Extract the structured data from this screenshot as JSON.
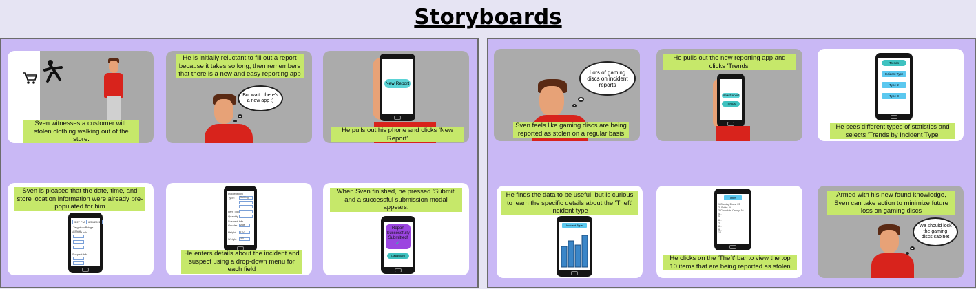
{
  "page": {
    "title": "Storyboards"
  },
  "colors": {
    "caption_bg": "#c6e86a",
    "board_bg": "#c9b8f5",
    "panel_gray": "#ababab",
    "shirt": "#d8231c",
    "teal": "#3fc2c0",
    "sky": "#5bc8ef",
    "purple": "#9b45e0"
  },
  "board1": {
    "p1": {
      "caption": "Sven witnesses a customer with stolen clothing walking out of the store."
    },
    "p2": {
      "caption": "He is initially reluctant to fill out a report because it takes so long, then remembers that there is a new and easy reporting app",
      "thought": "But wait...there's a new app :)"
    },
    "p3": {
      "caption": "He pulls out his phone and clicks 'New Report'",
      "button": "New Report"
    },
    "p4": {
      "caption": "Sven is pleased that the date, time, and store location information were already pre-populated for him",
      "time": "3:27 PM",
      "date": "6/24/2022",
      "target": "Target on Bridge - 03048",
      "incident_info": "Incident Info",
      "suspect_info": "Suspect Info"
    },
    "p5": {
      "caption": "He enters details about the incident and suspect using a drop-down menu for each field",
      "incident_info": "Incident Info",
      "type_label": "Type:",
      "type_value": "Clothing",
      "item_type_label": "Item Type",
      "quantity_label": "Quantity",
      "suspect_info": "Suspect Info",
      "gender_label": "Gender",
      "gender_value": "Male",
      "height_label": "Height",
      "height_value": "5'10",
      "weight_label": "Weight",
      "weight_value": "160"
    },
    "p6": {
      "caption": "When Sven finished, he pressed 'Submit' and a successful submission modal appears.",
      "modal": "Report Successfully Submitted!",
      "button": "Dashboard"
    }
  },
  "board2": {
    "p1": {
      "caption": "Sven feels like gaming discs are being reported as stolen on a regular basis",
      "thought": "Lots of gaming discs on incident reports"
    },
    "p2": {
      "caption": "He pulls out the new reporting app and clicks 'Trends'",
      "btn1": "New Report",
      "btn2": "Trends"
    },
    "p3": {
      "caption": "He sees different types of statistics and selects 'Trends by Incident Type'",
      "btn1": "Trends",
      "btn2": "Incident Type",
      "btn3": "Type 2",
      "btn4": "Type 3"
    },
    "p4": {
      "caption": "He finds the data to be useful, but is curious to learn the specific details about the 'Theft' incident type",
      "header": "Incident Type"
    },
    "p5": {
      "caption": "He clicks on the 'Theft' bar to view the top 10 items that are being reported as stolen",
      "header": "Theft",
      "items": [
        "1.Gaming Discs: 23",
        "2. Shirts: 18",
        "3.Chocolate Candy: 16",
        "4...",
        "5...",
        "6...",
        "7...",
        "8...",
        "9...",
        "10..."
      ]
    },
    "p6": {
      "caption": "Armed with his new found knowledge, Sven can take action to minimize future loss on gaming discs",
      "thought": "We should lock the gaming discs cabinet"
    }
  }
}
